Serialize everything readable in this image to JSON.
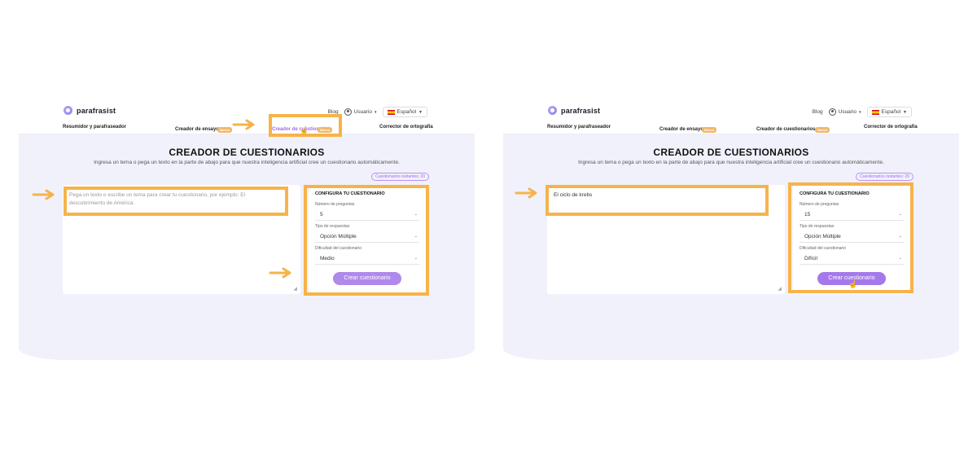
{
  "brand": {
    "name": "parafrasist"
  },
  "header": {
    "blog": "Blog",
    "user": "Usuario",
    "language": "Español"
  },
  "nav": {
    "items": [
      "Resumidor y parafraseador",
      "Creador de ensayos",
      "Creador de cuestionarios",
      "Corrector de ortografía"
    ],
    "badge": "Nuevo"
  },
  "page": {
    "title": "CREADOR DE CUESTIONARIOS",
    "subtitle": "Ingresa un tema o pega un texto en la parte de abajo para que nuestra inteligencia artificial cree un cuestionario automáticamente.",
    "quota": "Cuestionarios restantes: 20"
  },
  "config": {
    "title": "CONFIGURA TU CUESTIONARIO",
    "num_label": "Número de preguntas",
    "type_label": "Tipo de respuestas",
    "diff_label": "Dificultad del cuestionario",
    "button": "Crear cuestionario"
  },
  "left_screen": {
    "input_placeholder": "Pega un texto o escribe un tema para crear tu cuestionario, por ejemplo: El descubrimiento de América.",
    "num": "5",
    "type": "Opción Múltiple",
    "difficulty": "Medio"
  },
  "right_screen": {
    "input_value": "El ciclo de krebs",
    "num": "15",
    "type": "Opción Múltiple",
    "difficulty": "Difícil"
  },
  "colors": {
    "highlight": "#f6b34a",
    "accent": "#9b6de0",
    "button": "#b089ec",
    "badge": "#f0b86a"
  },
  "icons": [
    "logo-icon",
    "user-icon",
    "spain-flag-icon",
    "chevron-down-icon",
    "arrow-right-icon",
    "pointer-cursor-icon",
    "resize-handle-icon"
  ]
}
